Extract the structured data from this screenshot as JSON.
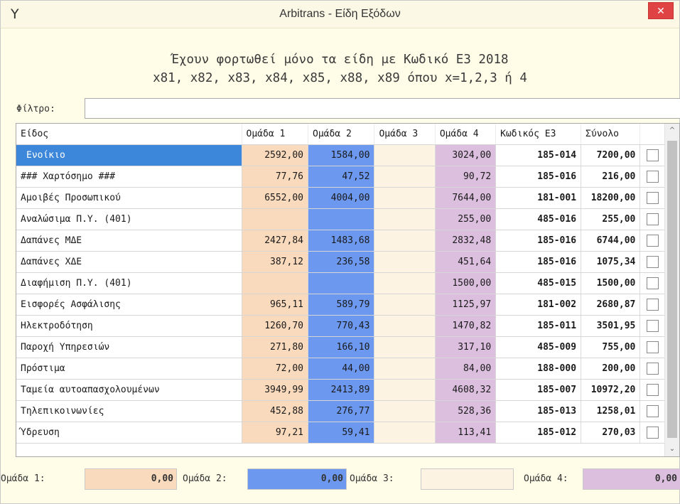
{
  "window": {
    "title": "Arbitrans - Είδη Εξόδων",
    "icon": "arbitrans-logo-icon",
    "close_glyph": "✕"
  },
  "note": {
    "line1": "Έχουν φορτωθεί μόνο τα είδη με Κωδικό Ε3 2018",
    "line2": "x81, x82, x83, x84, x85, x88, x89 όπου x=1,2,3 ή 4"
  },
  "filter": {
    "label": "Φίλτρο:",
    "value": ""
  },
  "colors": {
    "group1": "#fadabd",
    "group2": "#6c99ef",
    "group3": "#fdf3e3",
    "group4": "#dcbfdf",
    "selected": "#3d87db"
  },
  "table": {
    "headers": [
      "Είδος",
      "Ομάδα 1",
      "Ομάδα 2",
      "Ομάδα 3",
      "Ομάδα 4",
      "Κωδικός Ε3",
      "Σύνολο",
      ""
    ],
    "rows": [
      {
        "name": "Ενοίκιο",
        "g1": "2592,00",
        "g2": "1584,00",
        "g3": "",
        "g4": "3024,00",
        "code": "185-014",
        "total": "7200,00",
        "checked": false,
        "selected": true
      },
      {
        "name": "### Χαρτόσημο ###",
        "g1": "77,76",
        "g2": "47,52",
        "g3": "",
        "g4": "90,72",
        "code": "185-016",
        "total": "216,00",
        "checked": false,
        "selected": false
      },
      {
        "name": "Αμοιβές Προσωπικού",
        "g1": "6552,00",
        "g2": "4004,00",
        "g3": "",
        "g4": "7644,00",
        "code": "181-001",
        "total": "18200,00",
        "checked": false,
        "selected": false
      },
      {
        "name": "Αναλώσιμα Π.Υ. (401)",
        "g1": "",
        "g2": "",
        "g3": "",
        "g4": "255,00",
        "code": "485-016",
        "total": "255,00",
        "checked": false,
        "selected": false
      },
      {
        "name": "Δαπάνες ΜΔΕ",
        "g1": "2427,84",
        "g2": "1483,68",
        "g3": "",
        "g4": "2832,48",
        "code": "185-016",
        "total": "6744,00",
        "checked": false,
        "selected": false
      },
      {
        "name": "Δαπάνες ΧΔΕ",
        "g1": "387,12",
        "g2": "236,58",
        "g3": "",
        "g4": "451,64",
        "code": "185-016",
        "total": "1075,34",
        "checked": false,
        "selected": false
      },
      {
        "name": "Διαφήμιση Π.Υ. (401)",
        "g1": "",
        "g2": "",
        "g3": "",
        "g4": "1500,00",
        "code": "485-015",
        "total": "1500,00",
        "checked": false,
        "selected": false
      },
      {
        "name": "Εισφορές Ασφάλισης",
        "g1": "965,11",
        "g2": "589,79",
        "g3": "",
        "g4": "1125,97",
        "code": "181-002",
        "total": "2680,87",
        "checked": false,
        "selected": false
      },
      {
        "name": "Ηλεκτροδότηση",
        "g1": "1260,70",
        "g2": "770,43",
        "g3": "",
        "g4": "1470,82",
        "code": "185-011",
        "total": "3501,95",
        "checked": false,
        "selected": false
      },
      {
        "name": "Παροχή Υπηρεσιών",
        "g1": "271,80",
        "g2": "166,10",
        "g3": "",
        "g4": "317,10",
        "code": "485-009",
        "total": "755,00",
        "checked": false,
        "selected": false
      },
      {
        "name": "Πρόστιμα",
        "g1": "72,00",
        "g2": "44,00",
        "g3": "",
        "g4": "84,00",
        "code": "188-000",
        "total": "200,00",
        "checked": false,
        "selected": false
      },
      {
        "name": "Ταμεία αυτοαπασχολουμένων",
        "g1": "3949,99",
        "g2": "2413,89",
        "g3": "",
        "g4": "4608,32",
        "code": "185-007",
        "total": "10972,20",
        "checked": false,
        "selected": false
      },
      {
        "name": "Τηλεπικοινωνίες",
        "g1": "452,88",
        "g2": "276,77",
        "g3": "",
        "g4": "528,36",
        "code": "185-013",
        "total": "1258,01",
        "checked": false,
        "selected": false
      },
      {
        "name": "Ύδρευση",
        "g1": "97,21",
        "g2": "59,41",
        "g3": "",
        "g4": "113,41",
        "code": "185-012",
        "total": "270,03",
        "checked": false,
        "selected": false
      }
    ]
  },
  "scrollbar": {
    "up_glyph": "^",
    "down_glyph": "⌄"
  },
  "totals": {
    "g1_label": "Ομάδα 1:",
    "g1_value": "0,00",
    "g2_label": "Ομάδα 2:",
    "g2_value": "0,00",
    "g3_label": "Ομάδα 3:",
    "g3_value": "",
    "g4_label": "Ομάδα 4:",
    "g4_value": "0,00"
  }
}
